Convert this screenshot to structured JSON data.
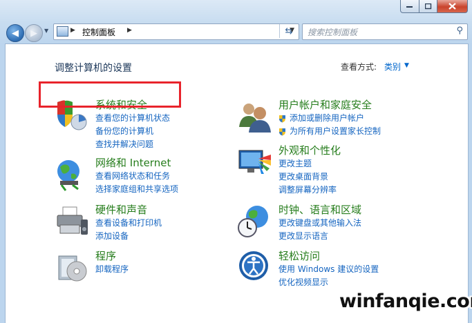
{
  "address": {
    "breadcrumb": "控制面板",
    "breadcrumb_icon": "control-panel-icon"
  },
  "search": {
    "placeholder": "搜索控制面板"
  },
  "page": {
    "title": "调整计算机的设置",
    "view_by_label": "查看方式:",
    "view_by_value": "类别"
  },
  "categories": [
    {
      "title": "系统和安全",
      "icon": "shield-computer-icon",
      "links": [
        "查看您的计算机状态",
        "备份您的计算机",
        "查找并解决问题"
      ]
    },
    {
      "title": "网络和 Internet",
      "icon": "network-globe-icon",
      "links": [
        "查看网络状态和任务",
        "选择家庭组和共享选项"
      ]
    },
    {
      "title": "硬件和声音",
      "icon": "printer-icon",
      "links": [
        "查看设备和打印机",
        "添加设备"
      ]
    },
    {
      "title": "程序",
      "icon": "programs-icon",
      "links": [
        "卸载程序"
      ]
    },
    {
      "title": "用户帐户和家庭安全",
      "icon": "users-icon",
      "links": [
        "添加或删除用户帐户",
        "为所有用户设置家长控制"
      ]
    },
    {
      "title": "外观和个性化",
      "icon": "appearance-icon",
      "links": [
        "更改主题",
        "更改桌面背景",
        "调整屏幕分辨率"
      ]
    },
    {
      "title": "时钟、语言和区域",
      "icon": "clock-globe-icon",
      "links": [
        "更改键盘或其他输入法",
        "更改显示语言"
      ]
    },
    {
      "title": "轻松访问",
      "icon": "ease-of-access-icon",
      "links": [
        "使用 Windows 建议的设置",
        "优化视频显示"
      ]
    }
  ],
  "watermark": "winfanqie.com",
  "colors": {
    "category_title": "#267d1c",
    "link": "#1565c0",
    "highlight": "#e8232b"
  }
}
